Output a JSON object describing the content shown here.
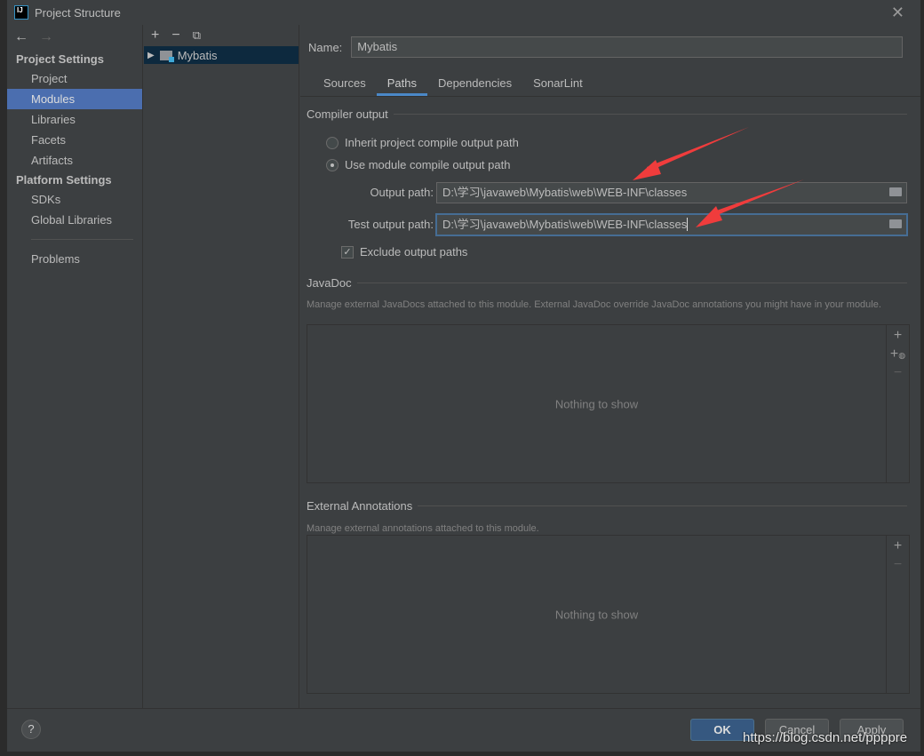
{
  "window": {
    "title": "Project Structure",
    "logo": "IJ",
    "close_icon": "close-icon"
  },
  "sidebar": {
    "sections": [
      {
        "title": "Project Settings",
        "items": [
          "Project",
          "Modules",
          "Libraries",
          "Facets",
          "Artifacts"
        ]
      },
      {
        "title": "Platform Settings",
        "items": [
          "SDKs",
          "Global Libraries"
        ]
      }
    ],
    "extra": "Problems",
    "selected": "Modules"
  },
  "modules": {
    "tree": [
      {
        "label": "Mybatis",
        "selected": true
      }
    ]
  },
  "main": {
    "name_label": "Name:",
    "name_value": "Mybatis",
    "tabs": [
      {
        "label": "Sources"
      },
      {
        "label": "Paths",
        "selected": true
      },
      {
        "label": "Dependencies"
      },
      {
        "label": "SonarLint"
      }
    ],
    "compiler_output": {
      "title": "Compiler output",
      "inherit_label": "Inherit project compile output path",
      "use_module_label": "Use module compile output path",
      "selected_option": "use_module",
      "output_label": "Output path:",
      "output_value": "D:\\学习\\javaweb\\Mybatis\\web\\WEB-INF\\classes",
      "test_label": "Test output path:",
      "test_value": "D:\\学习\\javaweb\\Mybatis\\web\\WEB-INF\\classes",
      "exclude_label": "Exclude output paths",
      "exclude_checked": true
    },
    "javadoc": {
      "title": "JavaDoc",
      "desc": "Manage external JavaDocs attached to this module. External JavaDoc override JavaDoc annotations you might have in your module.",
      "empty": "Nothing to show"
    },
    "annotations": {
      "title": "External Annotations",
      "desc": "Manage external annotations attached to this module.",
      "empty": "Nothing to show"
    }
  },
  "footer": {
    "help": "?",
    "ok": "OK",
    "cancel": "Cancel",
    "apply": "Apply"
  },
  "watermark": "https://blog.csdn.net/ppppre",
  "colors": {
    "accent": "#4b6eaf",
    "arrow": "#f03c3c",
    "ok": "#365880"
  }
}
